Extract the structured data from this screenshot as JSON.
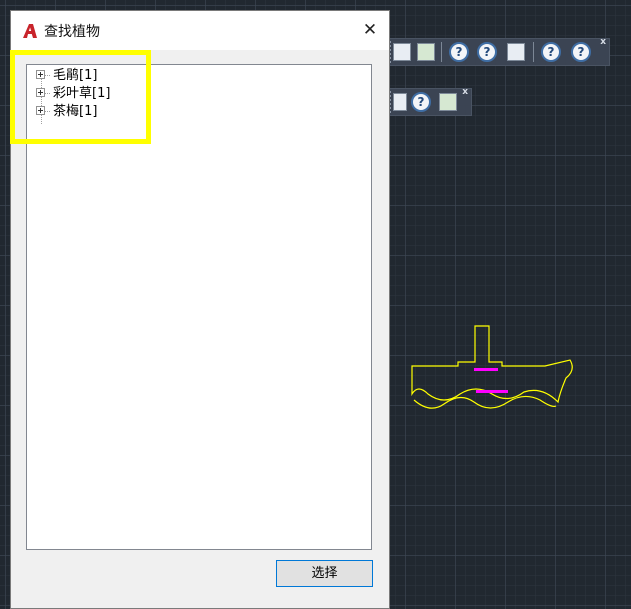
{
  "dialog": {
    "title": "查找植物",
    "close_glyph": "✕",
    "select_button": "选择"
  },
  "tree": {
    "items": [
      {
        "label": "毛鹃[1]"
      },
      {
        "label": "彩叶草[1]"
      },
      {
        "label": "茶梅[1]"
      }
    ]
  },
  "toolbars": {
    "close_glyph": "x",
    "help_glyph": "?"
  },
  "colors": {
    "canvas_bg": "#212830",
    "highlight": "#ffff00",
    "drawing_outline": "#ffff00",
    "drawing_text": "#ff00ff",
    "autocad_red": "#c8242b"
  }
}
